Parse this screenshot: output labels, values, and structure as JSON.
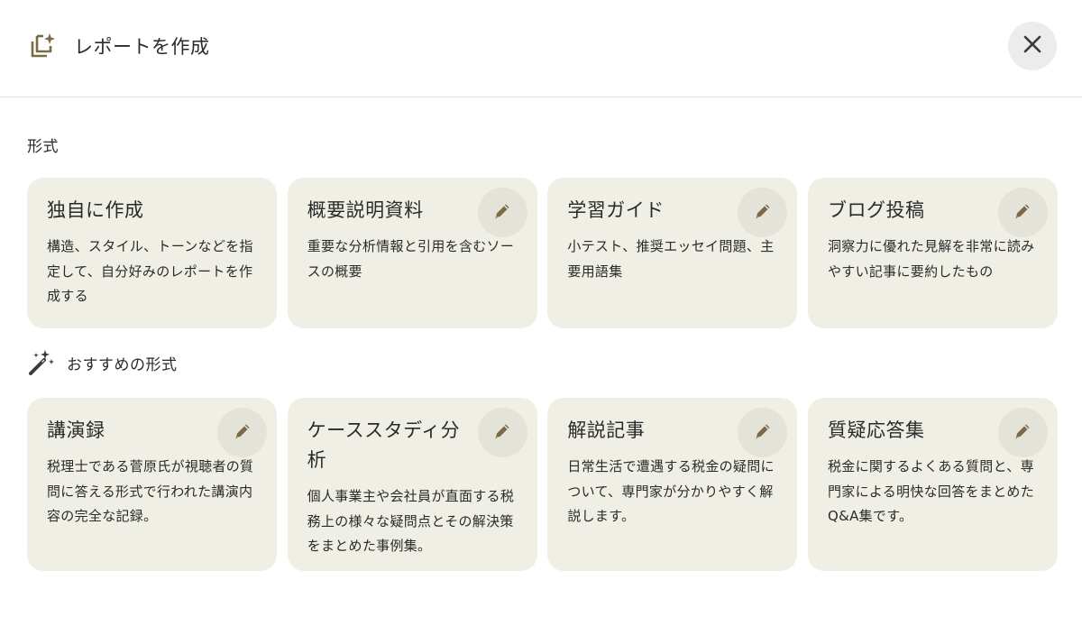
{
  "dialog": {
    "title": "レポートを作成",
    "header_icon": "report-sparkle-icon",
    "close_icon": "close-icon"
  },
  "formats": {
    "label": "形式",
    "cards": [
      {
        "title": "独自に作成",
        "description": "構造、スタイル、トーンなどを指定して、自分好みのレポートを作成する",
        "editable": false
      },
      {
        "title": "概要説明資料",
        "description": "重要な分析情報と引用を含むソースの概要",
        "editable": true
      },
      {
        "title": "学習ガイド",
        "description": "小テスト、推奨エッセイ問題、主要用語集",
        "editable": true
      },
      {
        "title": "ブログ投稿",
        "description": "洞察力に優れた見解を非常に読みやすい記事に要約したもの",
        "editable": true
      }
    ]
  },
  "recommended": {
    "label": "おすすめの形式",
    "icon": "magic-wand-icon",
    "cards": [
      {
        "title": "講演録",
        "description": "税理士である菅原氏が視聴者の質問に答える形式で行われた講演内容の完全な記録。",
        "editable": true
      },
      {
        "title": "ケーススタディ分析",
        "description": "個人事業主や会社員が直面する税務上の様々な疑問点とその解決策をまとめた事例集。",
        "editable": true
      },
      {
        "title": "解説記事",
        "description": "日常生活で遭遇する税金の疑問について、専門家が分かりやすく解説します。",
        "editable": true
      },
      {
        "title": "質疑応答集",
        "description": "税金に関するよくある質問と、専門家による明快な回答をまとめたQ&A集です。",
        "editable": true
      }
    ]
  },
  "colors": {
    "accent": "#7a6a45",
    "card_bg": "#f0efe6",
    "edit_button_bg": "#e4e3d9"
  }
}
